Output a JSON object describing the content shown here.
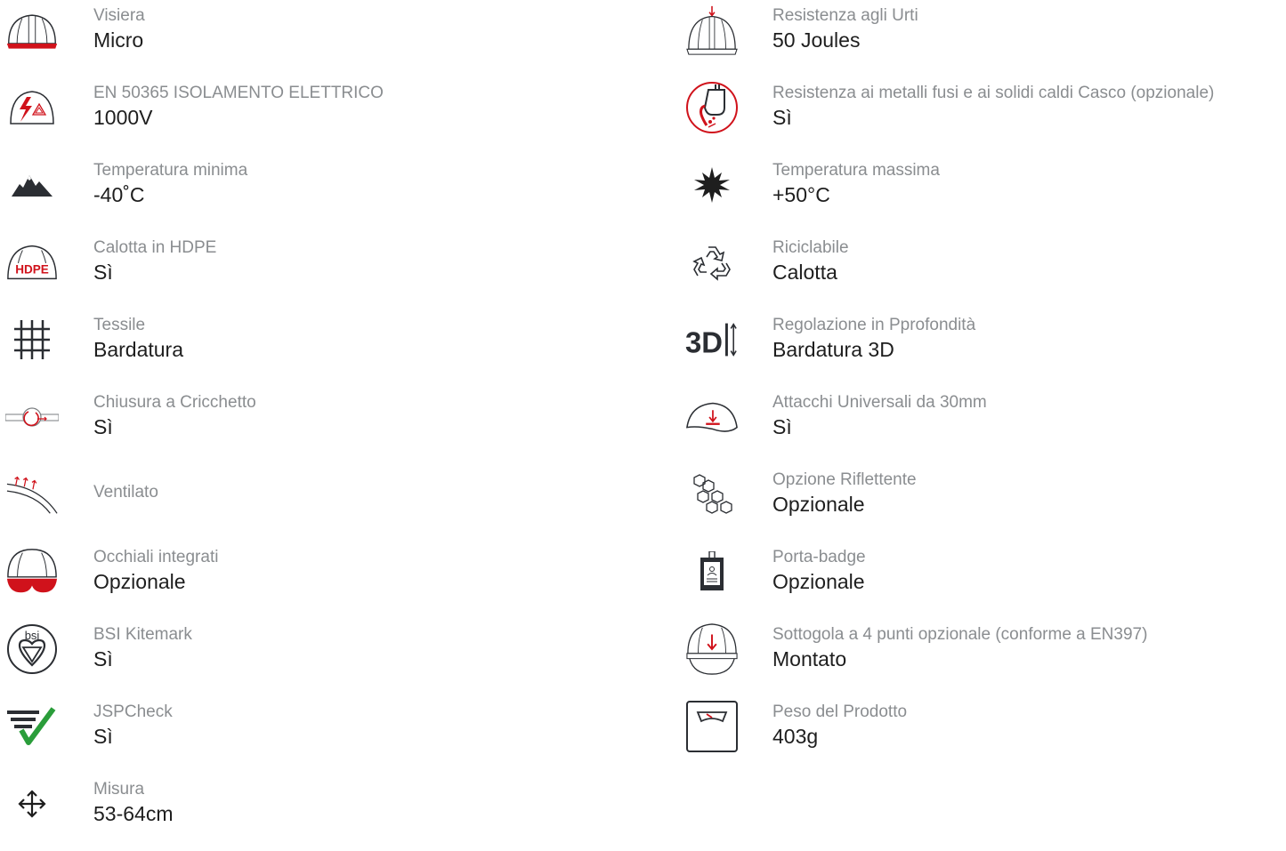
{
  "colors": {
    "label": "#8a8d90",
    "value": "#1e1e1e",
    "accent": "#d0121b",
    "icon": "#2b2e33",
    "check": "#2a9d3a"
  },
  "left": [
    {
      "icon": "visor-helmet-icon",
      "label": "Visiera",
      "value": "Micro"
    },
    {
      "icon": "electrical-insulation-icon",
      "label": "EN 50365 ISOLAMENTO ELETTRICO",
      "value": "1000V"
    },
    {
      "icon": "mountains-icon",
      "label": "Temperatura minima",
      "value": "-40˚C"
    },
    {
      "icon": "hdpe-helmet-icon",
      "label": "Calotta in HDPE",
      "value": "Sì"
    },
    {
      "icon": "textile-weave-icon",
      "label": "Tessile",
      "value": "Bardatura"
    },
    {
      "icon": "ratchet-icon",
      "label": "Chiusura a Cricchetto",
      "value": "Sì"
    },
    {
      "icon": "ventilation-icon",
      "label": "Ventilato",
      "value": ""
    },
    {
      "icon": "helmet-goggles-icon",
      "label": "Occhiali integrati",
      "value": "Opzionale"
    },
    {
      "icon": "bsi-kitemark-icon",
      "label": "BSI Kitemark",
      "value": "Sì"
    },
    {
      "icon": "jspcheck-icon",
      "label": "JSPCheck",
      "value": "Sì"
    },
    {
      "icon": "size-arrows-icon",
      "label": "Misura",
      "value": "53-64cm"
    }
  ],
  "right": [
    {
      "icon": "impact-helmet-icon",
      "label": "Resistenza agli Urti",
      "value": "50 Joules"
    },
    {
      "icon": "molten-metal-icon",
      "label": "Resistenza ai metalli fusi e ai solidi caldi Casco (opzionale)",
      "value": "Sì"
    },
    {
      "icon": "sun-icon",
      "label": "Temperatura massima",
      "value": "+50°C"
    },
    {
      "icon": "recycle-icon",
      "label": "Riciclabile",
      "value": "Calotta"
    },
    {
      "icon": "3d-adjust-icon",
      "label": "Regolazione in Pprofondità",
      "value": "Bardatura 3D"
    },
    {
      "icon": "universal-slot-icon",
      "label": "Attacchi Universali da 30mm",
      "value": "Sì"
    },
    {
      "icon": "reflective-hex-icon",
      "label": "Opzione Riflettente",
      "value": "Opzionale"
    },
    {
      "icon": "badge-holder-icon",
      "label": "Porta-badge",
      "value": "Opzionale"
    },
    {
      "icon": "chinstrap-helmet-icon",
      "label": "Sottogola a 4 punti opzionale (conforme a EN397)",
      "value": "Montato"
    },
    {
      "icon": "weight-scale-icon",
      "label": "Peso del Prodotto",
      "value": "403g"
    }
  ]
}
